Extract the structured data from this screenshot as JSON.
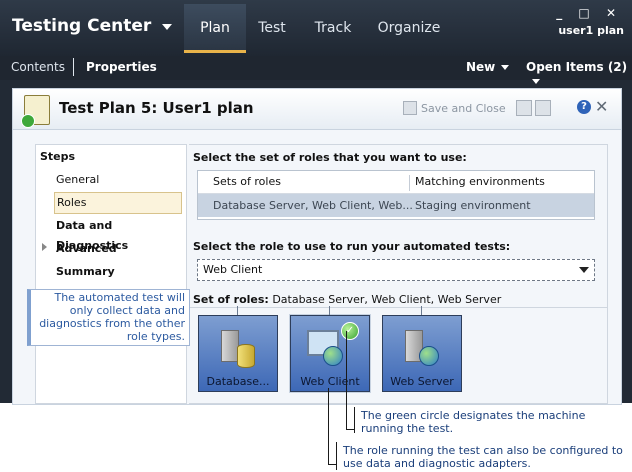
{
  "app": {
    "title": "Testing Center",
    "user": "user1 plan",
    "tabs": [
      {
        "label": "Plan",
        "active": true
      },
      {
        "label": "Test",
        "active": false
      },
      {
        "label": "Track",
        "active": false
      },
      {
        "label": "Organize",
        "active": false
      }
    ],
    "window_controls": "_ □ ✕"
  },
  "subnav": {
    "contents": "Contents",
    "properties": "Properties",
    "new": "New",
    "open_items": "Open Items (2)"
  },
  "header": {
    "title": "Test Plan 5: User1 plan",
    "save_close": "Save and Close",
    "help": "?",
    "close": "✕"
  },
  "steps": {
    "title": "Steps",
    "items": [
      "General",
      "Roles",
      "Data and Diagnostics",
      "Advanced",
      "Summary"
    ]
  },
  "roles_panel": {
    "select_set_label": "Select the set of roles that you want to use:",
    "grid_headers": [
      "Sets of roles",
      "Matching environments"
    ],
    "grid_row": [
      "Database Server, Web Client, Web...",
      "Staging environment"
    ],
    "select_role_label": "Select the role to use to run your automated tests:",
    "selected_role": "Web Client",
    "set_of_roles_label": "Set of roles:",
    "set_of_roles_value": "Database Server, Web Client, Web Server",
    "roles": [
      "Database...",
      "Web Client",
      "Web Server"
    ]
  },
  "callouts": {
    "left": "The automated test will only collect data and diagnostics from the other role types.",
    "green_circle": "The green circle designates the machine running the test.",
    "role_running": "The role running the test can also be configured to use data and diagnostic adapters."
  },
  "colors": {
    "accent": "#e8b34a",
    "topbar": "#2f3a48",
    "role_tile": "#5a82c4",
    "callout_text": "#1a3e7a"
  }
}
